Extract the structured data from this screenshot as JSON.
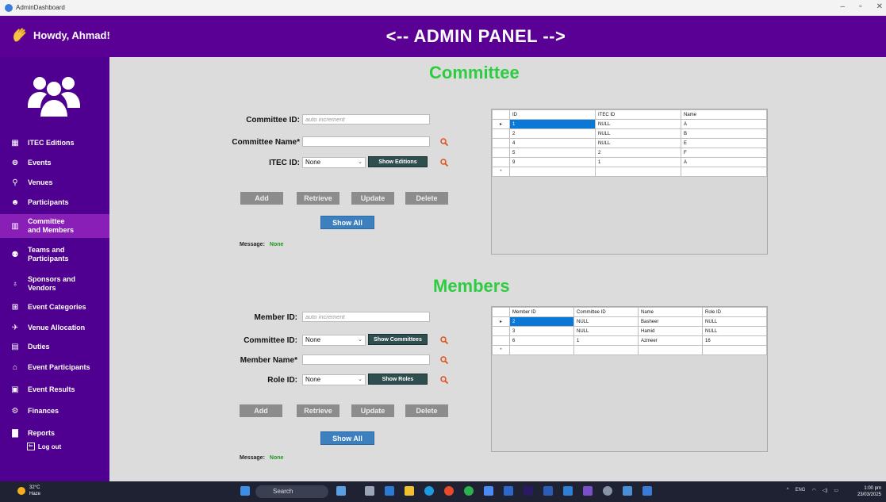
{
  "window": {
    "title": "AdminDashboard",
    "controls": [
      "–",
      "▫",
      "✕"
    ]
  },
  "header": {
    "greeting": "Howdy, Ahmad!",
    "title": "<-- ADMIN PANEL -->"
  },
  "sidebar": {
    "items": [
      {
        "label": "ITEC Editions",
        "icon": "calendar-icon"
      },
      {
        "label": "Events",
        "icon": "events-icon"
      },
      {
        "label": "Venues",
        "icon": "location-pin-icon"
      },
      {
        "label": "Participants",
        "icon": "participants-icon"
      },
      {
        "label": "Committee\nand Members",
        "icon": "committee-icon",
        "active": true
      },
      {
        "label": "Teams and\nParticipants",
        "icon": "teams-icon"
      },
      {
        "label": "Sponsors and\nVendors",
        "icon": "money-bag-icon"
      },
      {
        "label": "Event Categories",
        "icon": "categories-icon"
      },
      {
        "label": "Venue Allocation",
        "icon": "pin-icon"
      },
      {
        "label": "Duties",
        "icon": "clipboard-icon"
      },
      {
        "label": "Event Participants",
        "icon": "bank-icon"
      },
      {
        "label": "Event Results",
        "icon": "results-icon"
      },
      {
        "label": "Finances",
        "icon": "finances-icon"
      },
      {
        "label": "Reports",
        "icon": "report-icon"
      }
    ],
    "logout": "Log out"
  },
  "committee": {
    "title": "Committee",
    "id_label": "Committee ID:",
    "id_placeholder": "auto increment",
    "name_label": "Committee Name*",
    "itec_label": "ITEC ID:",
    "itec_value": "None",
    "show_editions": "Show Editions",
    "buttons": {
      "add": "Add",
      "retrieve": "Retrieve",
      "update": "Update",
      "delete": "Delete",
      "show_all": "Show All"
    },
    "message_label": "Message:",
    "message_value": "None",
    "grid": {
      "columns": [
        "ID",
        "ITEC ID",
        "Name"
      ],
      "rows": [
        [
          "1",
          "NULL",
          "A"
        ],
        [
          "2",
          "NULL",
          "B"
        ],
        [
          "4",
          "NULL",
          "E"
        ],
        [
          "5",
          "2",
          "F"
        ],
        [
          "9",
          "1",
          "A"
        ]
      ]
    }
  },
  "members": {
    "title": "Members",
    "id_label": "Member ID:",
    "id_placeholder": "auto increment",
    "committee_label": "Committee ID:",
    "committee_value": "None",
    "show_committees": "Show Committees",
    "name_label": "Member Name*",
    "role_label": "Role ID:",
    "role_value": "None",
    "show_roles": "Show Roles",
    "buttons": {
      "add": "Add",
      "retrieve": "Retrieve",
      "update": "Update",
      "delete": "Delete",
      "show_all": "Show All"
    },
    "message_label": "Message:",
    "message_value": "None",
    "grid": {
      "columns": [
        "Member ID",
        "Committee ID",
        "Name",
        "Role ID"
      ],
      "rows": [
        [
          "2",
          "NULL",
          "Basheer",
          "NULL"
        ],
        [
          "3",
          "NULL",
          "Hamid",
          "NULL"
        ],
        [
          "6",
          "1",
          "Azmeer",
          "16"
        ]
      ]
    }
  },
  "taskbar": {
    "temperature": "32°C",
    "weather": "Haze",
    "search": "Search",
    "lang": "ENG",
    "time": "1:00 pm",
    "date": "23/03/2025"
  }
}
